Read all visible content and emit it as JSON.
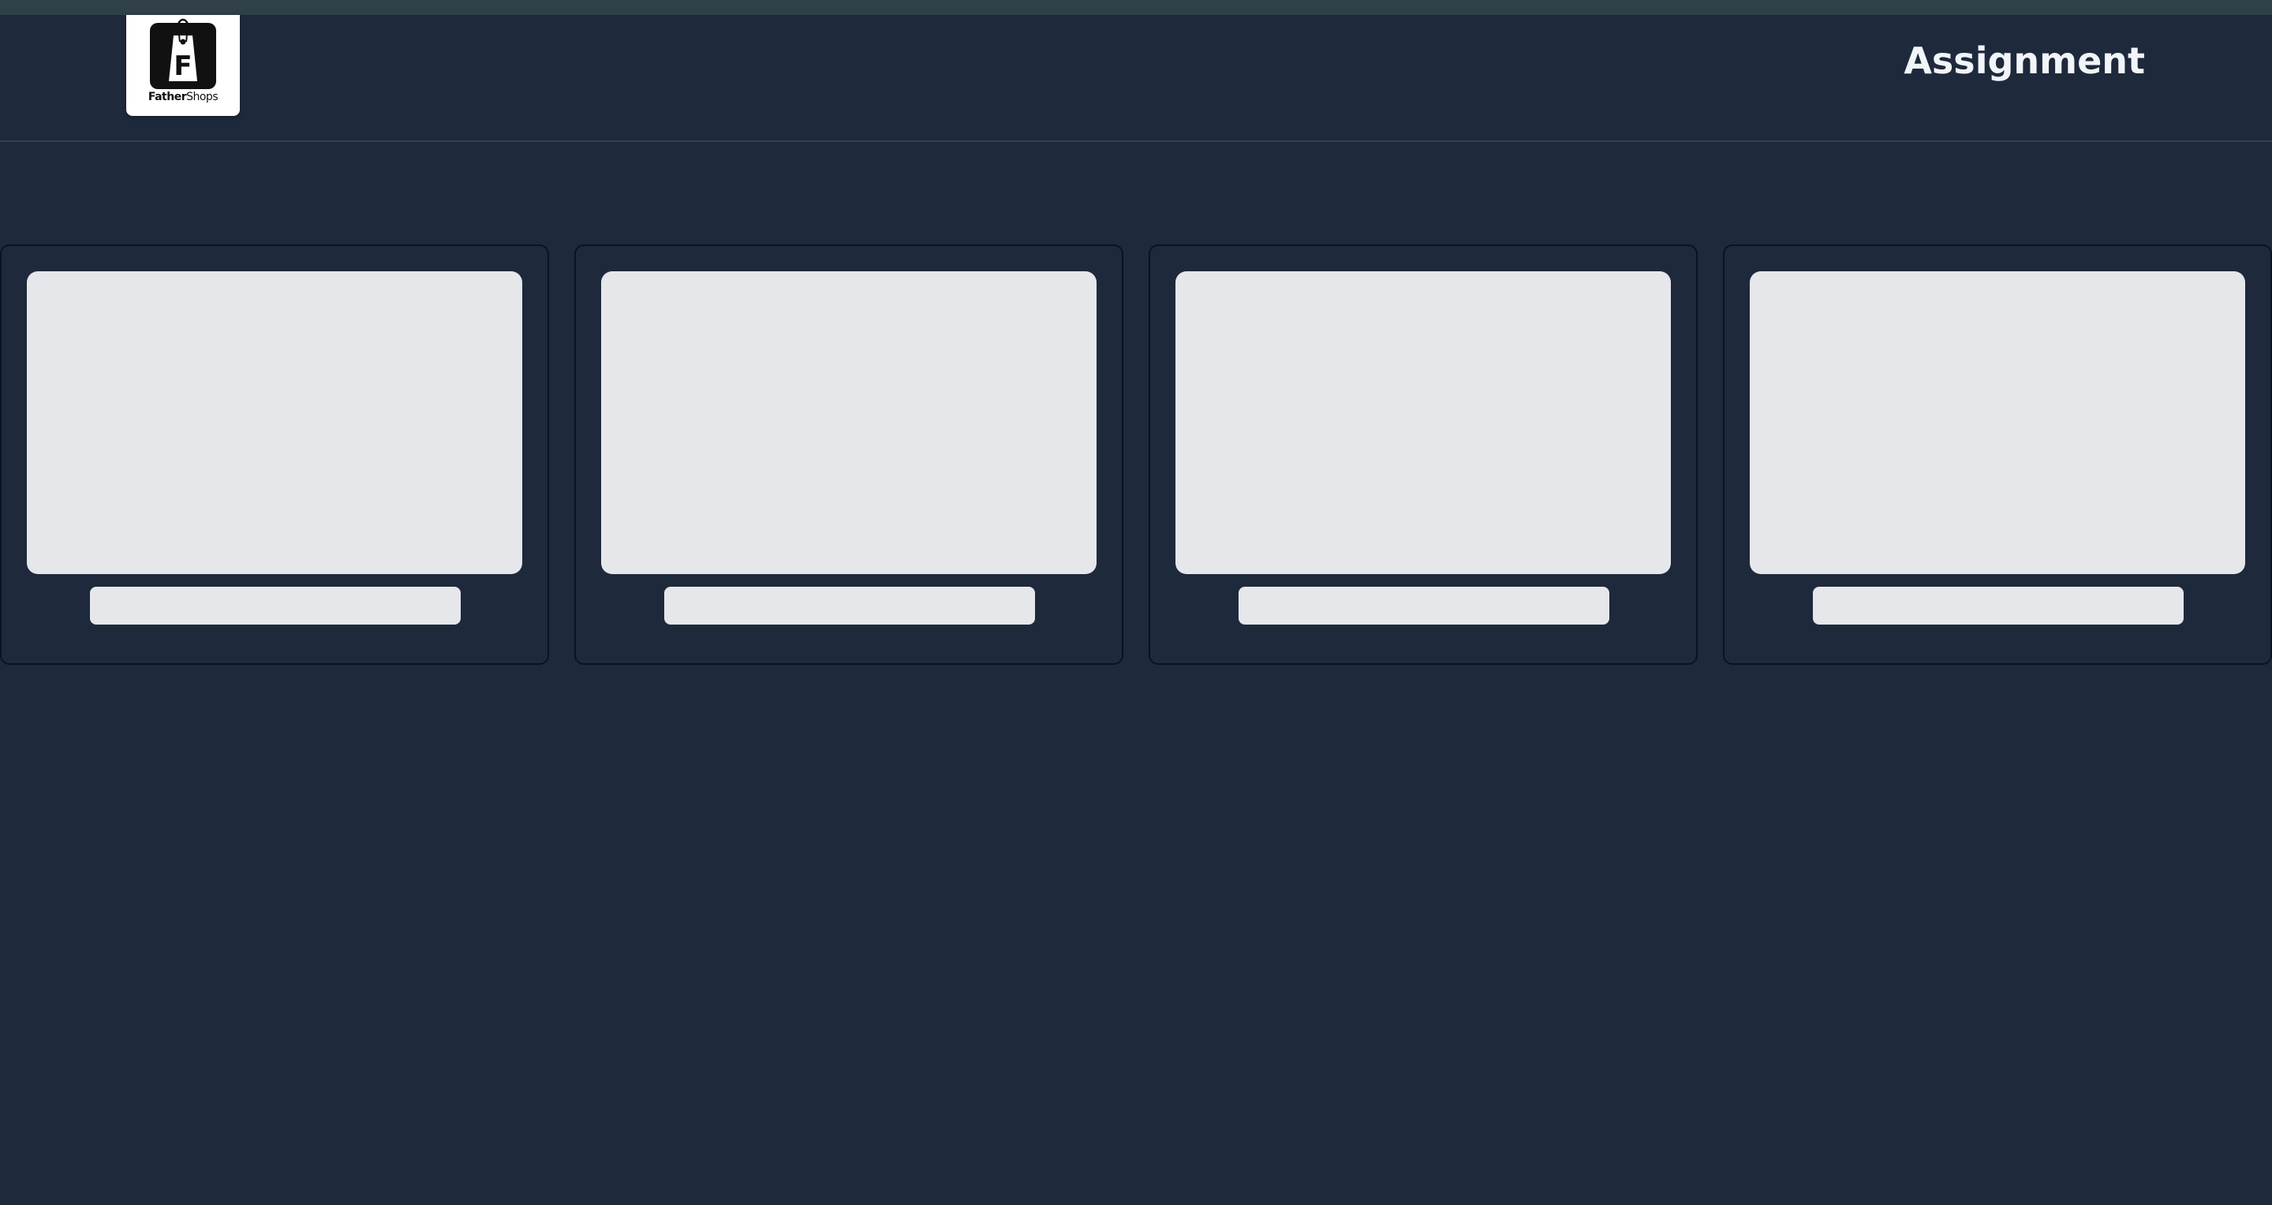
{
  "header": {
    "logo": {
      "letter": "F",
      "brand_bold": "Father",
      "brand_regular": "Shops"
    },
    "title": "Assignment"
  },
  "colors": {
    "background": "#1e293b",
    "top_strip": "#2f4048",
    "placeholder": "#e5e7eb",
    "title_text": "#f1f5f9"
  },
  "cards": [
    {
      "state": "loading"
    },
    {
      "state": "loading"
    },
    {
      "state": "loading"
    },
    {
      "state": "loading"
    }
  ]
}
